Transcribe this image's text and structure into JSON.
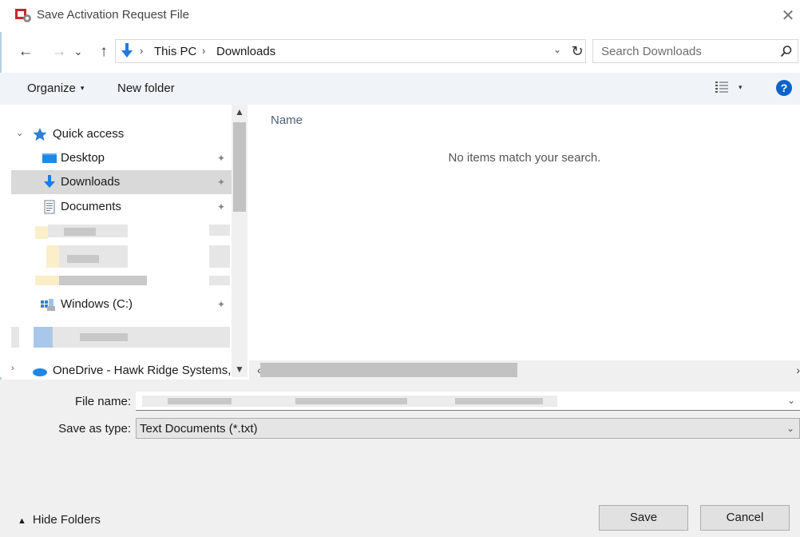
{
  "window": {
    "title": "Save Activation Request File",
    "close_glyph": "✕",
    "app_icon": "app-icon"
  },
  "nav": {
    "back_glyph": "←",
    "forward_glyph": "→",
    "recent_glyph": "⌄",
    "up_glyph": "↑",
    "breadcrumbs": [
      "This PC",
      "Downloads"
    ],
    "crumb_separator": "›",
    "dropdown_glyph": "⌄",
    "refresh_glyph": "↻",
    "search_placeholder": "Search Downloads"
  },
  "commands": {
    "organize_label": "Organize",
    "organize_caret": "▾",
    "new_folder_label": "New folder",
    "view_caret": "▾",
    "help_glyph": "?"
  },
  "sidebar": {
    "quick_access_label": "Quick access",
    "items": [
      {
        "label": "Desktop",
        "icon": "desktop-icon",
        "pinned": true
      },
      {
        "label": "Downloads",
        "icon": "download-arrow-icon",
        "pinned": true,
        "selected": true
      },
      {
        "label": "Documents",
        "icon": "documents-icon",
        "pinned": true
      },
      {
        "label": "Windows (C:)",
        "icon": "drive-icon",
        "pinned": true
      }
    ],
    "onedrive_label": "OneDrive - Hawk Ridge Systems,",
    "pin_glyph": "📌",
    "expander_glyph": "⌄"
  },
  "file_list": {
    "column_name": "Name",
    "empty_message": "No items match your search."
  },
  "footer": {
    "file_name_label": "File name:",
    "file_name_value": "",
    "save_as_type_label": "Save as type:",
    "save_as_type_value": "Text Documents (*.txt)",
    "hide_folders_label": "Hide Folders",
    "save_label": "Save",
    "cancel_label": "Cancel"
  },
  "colors": {
    "accent": "#0a64c8",
    "selection": "#d9d9d9",
    "command_bar": "#f0f4f9"
  }
}
